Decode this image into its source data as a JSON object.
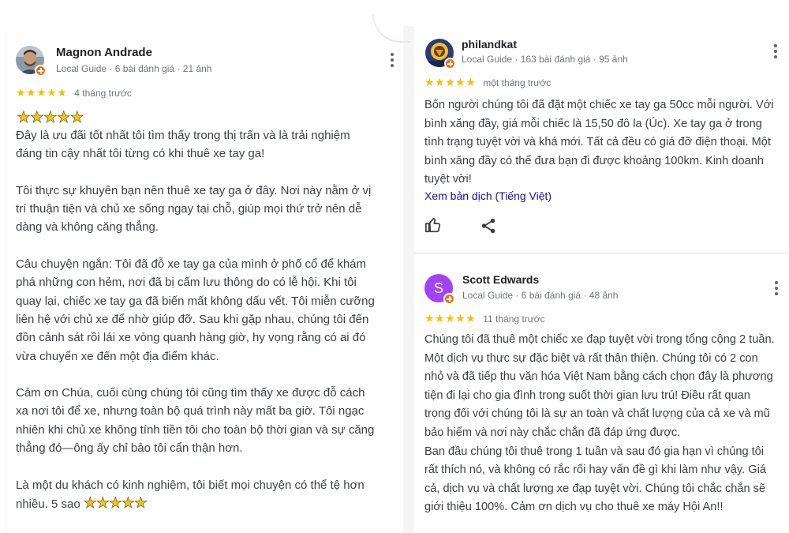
{
  "reviews": [
    {
      "author": "Magnon Andrade",
      "meta": "Local Guide · 6 bài đánh giá · 21 ảnh",
      "stars": "★★★★★",
      "time": "4 tháng trước",
      "big_stars": "★★★★★",
      "lines": [
        "Đây là ưu đãi tốt nhất tôi tìm thấy trong thị trấn và là trải nghiệm",
        "đáng tin cậy nhất tôi từng có khi thuê xe tay ga!",
        "",
        "Tôi thực sự khuyên bạn nên thuê xe tay ga ở đây. Nơi này nằm ở vị",
        "trí thuận tiện và chủ xe sống ngay tại chỗ, giúp mọi thứ trở nên dễ",
        "dàng và không căng thẳng.",
        "",
        "Câu chuyện ngắn: Tôi đã đỗ xe tay ga của mình ở phố cổ để khám",
        "phá những con hẻm, nơi đã bị cấm lưu thông do có lễ hội. Khi tôi",
        "quay lại, chiếc xe tay ga đã biến mất không dấu vết. Tôi miễn cưỡng",
        "liên hệ với chủ xe để nhờ giúp đỡ. Sau khi gặp nhau, chúng tôi đến",
        "đồn cảnh sát rồi lái xe vòng quanh hàng giờ, hy vọng rằng có ai đó",
        "vừa chuyển xe đến một địa điểm khác.",
        "",
        "Cảm ơn Chúa, cuối cùng chúng tôi cũng tìm thấy xe được đỗ cách",
        "xa nơi tôi để xe, nhưng toàn bộ quá trình này mất ba giờ. Tôi ngạc",
        "nhiên khi chủ xe không tính tiền tôi cho toàn bộ thời gian và sự căng",
        "thẳng đó—ông ấy chỉ bảo tôi cẩn thận hơn.",
        "",
        "Là một du khách có kinh nghiệm, tôi biết mọi chuyện có thể tệ hơn"
      ],
      "last_line": "nhiều. 5 sao",
      "last_line_stars": "★★★★★"
    },
    {
      "author": "philandkat",
      "meta": "Local Guide · 163 bài đánh giá · 95 ảnh",
      "stars": "★★★★★",
      "time": "một tháng trước",
      "lines": [
        "Bốn người chúng tôi đã đặt một chiếc xe tay ga 50cc mỗi người. Với",
        "bình xăng đầy, giá mỗi chiếc là 15,50 đô la (Úc). Xe tay ga ở trong",
        "tình trạng tuyệt vời và khá mới. Tất cả đều có giá đỡ điện thoại. Một",
        "bình xăng đầy có thể đưa bạn đi được khoảng 100km. Kinh doanh",
        "tuyệt vời!"
      ],
      "translate_link": "Xem bản dịch (Tiếng Việt)"
    },
    {
      "author": "Scott Edwards",
      "avatar_letter": "S",
      "meta": "Local Guide · 6 bài đánh giá · 48 ảnh",
      "stars": "★★★★★",
      "time": "11 tháng trước",
      "lines": [
        "Chúng tôi đã thuê một chiếc xe đạp tuyệt vời trong tổng cộng 2 tuần.",
        "Một dịch vụ thực sự đặc biệt và rất thân thiện. Chúng tôi có 2 con",
        "nhỏ và đã tiếp thu văn hóa Việt Nam bằng cách chọn đây là phương",
        "tiện đi lại cho gia đình trong suốt thời gian lưu trú! Điều rất quan",
        "trọng đối với chúng tôi là sự an toàn và chất lượng của cả xe và mũ",
        "bảo hiểm và nơi này chắc chắn đã đáp ứng được.",
        "Ban đầu chúng tôi thuê trong 1 tuần và sau đó gia hạn vì chúng tôi",
        "rất thích nó, và không có rắc rối hay vấn đề gì khi làm như vậy. Giá",
        "cả, dịch vụ và chất lượng xe đạp tuyệt vời. Chúng tôi chắc chắn sẽ",
        "giới thiệu 100%. Cảm ơn dịch vụ cho thuê xe máy Hội An!!"
      ]
    }
  ],
  "icons": [
    "thumbs-up-icon",
    "share-icon",
    "more-options-icon",
    "local-guide-badge-icon"
  ],
  "colors": {
    "star": "#fbbc04",
    "link": "#1a0dab",
    "badge": "#e8710a",
    "avatar_purple": "#a142f4"
  }
}
